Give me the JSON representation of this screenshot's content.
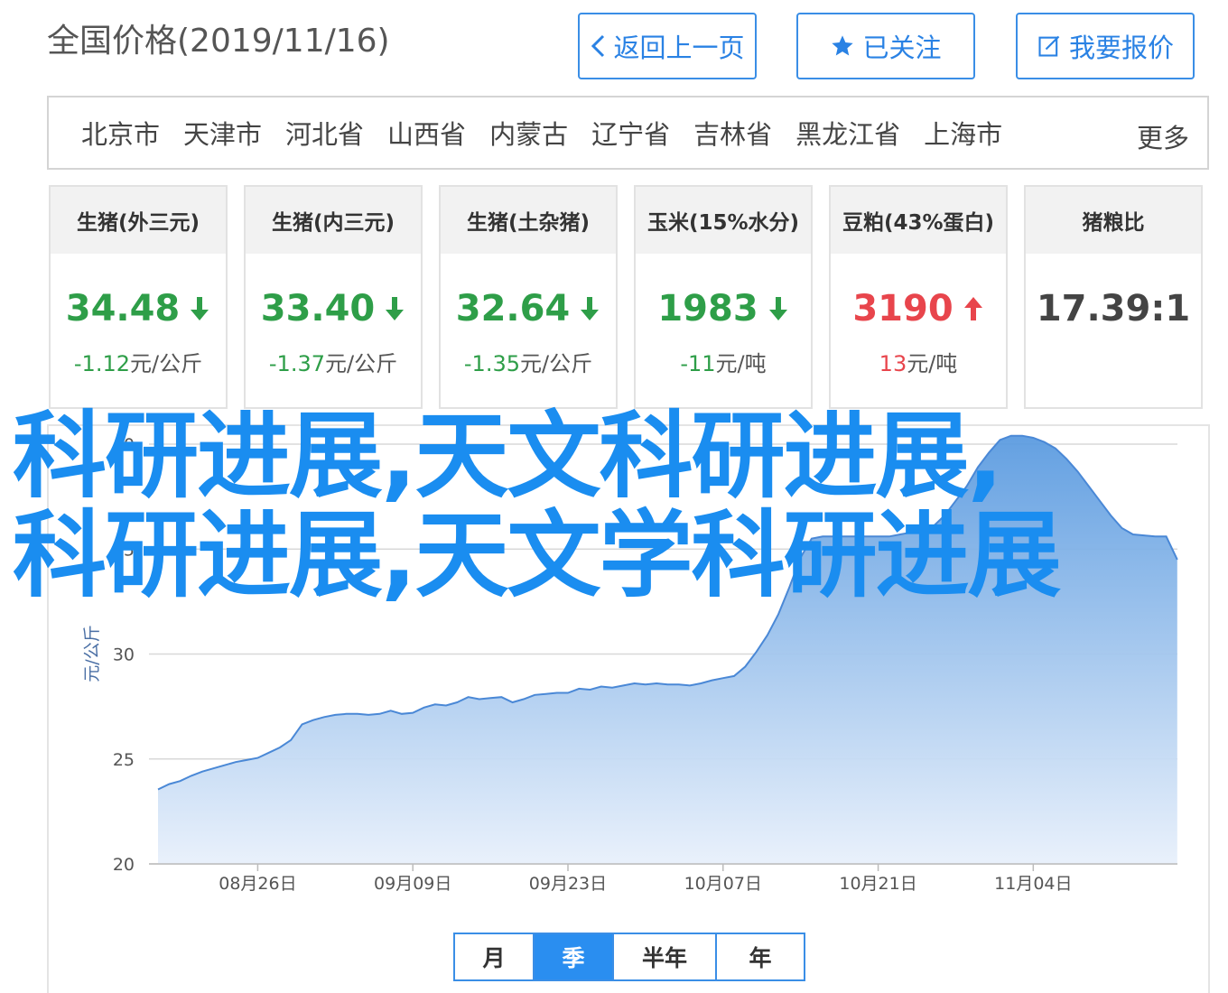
{
  "header": {
    "title": "全国价格(2019/11/16)"
  },
  "actions": {
    "back_label": "返回上一页",
    "follow_label": "已关注",
    "report_label": "我要报价"
  },
  "regions": {
    "items": [
      "北京市",
      "天津市",
      "河北省",
      "山西省",
      "内蒙古",
      "辽宁省",
      "吉林省",
      "黑龙江省",
      "上海市"
    ],
    "more_label": "更多"
  },
  "cards": [
    {
      "title": "生猪(外三元)",
      "price": "34.48",
      "trend": "down",
      "change": "-1.12",
      "unit": "元/公斤"
    },
    {
      "title": "生猪(内三元)",
      "price": "33.40",
      "trend": "down",
      "change": "-1.37",
      "unit": "元/公斤"
    },
    {
      "title": "生猪(土杂猪)",
      "price": "32.64",
      "trend": "down",
      "change": "-1.35",
      "unit": "元/公斤"
    },
    {
      "title": "玉米(15%水分)",
      "price": "1983",
      "trend": "down",
      "change": "-11",
      "unit": "元/吨"
    },
    {
      "title": "豆粕(43%蛋白)",
      "price": "3190",
      "trend": "up",
      "change": "13",
      "unit": "元/吨"
    },
    {
      "title": "猪粮比",
      "price": "17.39:1",
      "trend": "none",
      "change": "",
      "unit": ""
    }
  ],
  "colors": {
    "accent": "#2a8ef0",
    "down": "#2e9e48",
    "up": "#e8454c",
    "area_top": "#5b9be0",
    "line": "#4a88d6"
  },
  "chart_data": {
    "type": "area",
    "ylabel": "元/公斤",
    "ylim": [
      20,
      40
    ],
    "yticks": [
      20,
      25,
      30,
      35,
      40
    ],
    "grid": true,
    "x_ticks": [
      "08月26日",
      "09月09日",
      "09月23日",
      "10月07日",
      "10月21日",
      "11月04日"
    ],
    "x_tick_days": [
      9,
      23,
      37,
      51,
      65,
      79
    ],
    "days": [
      0,
      1,
      2,
      3,
      4,
      5,
      6,
      7,
      8,
      9,
      10,
      11,
      12,
      13,
      14,
      15,
      16,
      17,
      18,
      19,
      20,
      21,
      22,
      23,
      24,
      25,
      26,
      27,
      28,
      29,
      30,
      31,
      32,
      33,
      34,
      35,
      36,
      37,
      38,
      39,
      40,
      41,
      42,
      43,
      44,
      45,
      46,
      47,
      48,
      49,
      50,
      51,
      52,
      53,
      54,
      55,
      56,
      57,
      58,
      59,
      60,
      61,
      62,
      63,
      64,
      65,
      66,
      67,
      68,
      69,
      70,
      71,
      72,
      73,
      74,
      75,
      76,
      77,
      78,
      79,
      80,
      81,
      82,
      83,
      84,
      85,
      86,
      87,
      88,
      89,
      90,
      91,
      92
    ],
    "values": [
      23.55,
      23.8,
      23.95,
      24.2,
      24.4,
      24.55,
      24.7,
      24.85,
      24.95,
      25.05,
      25.3,
      25.55,
      25.9,
      26.65,
      26.85,
      27.0,
      27.1,
      27.15,
      27.15,
      27.1,
      27.15,
      27.3,
      27.15,
      27.2,
      27.45,
      27.6,
      27.55,
      27.7,
      27.95,
      27.85,
      27.9,
      27.95,
      27.7,
      27.85,
      28.05,
      28.1,
      28.15,
      28.15,
      28.35,
      28.3,
      28.45,
      28.4,
      28.5,
      28.6,
      28.55,
      28.6,
      28.55,
      28.55,
      28.5,
      28.6,
      28.75,
      28.85,
      28.95,
      29.4,
      30.1,
      30.9,
      31.9,
      33.2,
      34.6,
      35.5,
      35.6,
      35.6,
      35.6,
      35.6,
      35.6,
      35.6,
      35.6,
      35.7,
      35.8,
      35.9,
      36.1,
      36.6,
      37.3,
      38.0,
      38.9,
      39.6,
      40.2,
      40.4,
      40.4,
      40.3,
      40.1,
      39.8,
      39.3,
      38.7,
      38.0,
      37.3,
      36.6,
      36.0,
      35.7,
      35.65,
      35.6,
      35.6,
      34.5
    ]
  },
  "period_tabs": [
    {
      "label": "月",
      "active": false
    },
    {
      "label": "季",
      "active": true
    },
    {
      "label": "半年",
      "active": false
    },
    {
      "label": "年",
      "active": false
    }
  ],
  "overlay": {
    "line1": "科研进展,天文科研进展,",
    "line2": "科研进展,天文学科研进展"
  }
}
